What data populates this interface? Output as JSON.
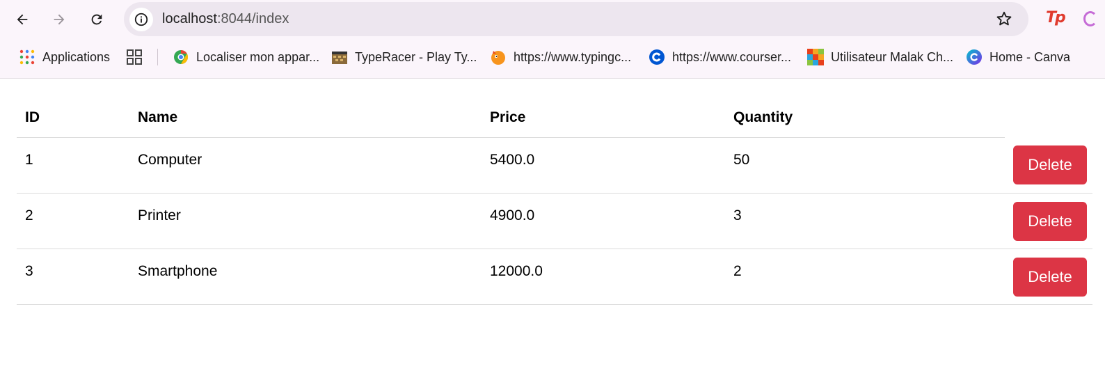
{
  "browser": {
    "url_host": "localhost",
    "url_path": ":8044/index",
    "extension_tp": "Tp",
    "bookmarks": [
      {
        "label": "Applications",
        "icon": "apps-grid-icon"
      },
      {
        "label": "",
        "icon": "tab-groups-icon"
      },
      {
        "label": "Localiser mon appar...",
        "icon": "google-find-device-icon"
      },
      {
        "label": "TypeRacer - Play Ty...",
        "icon": "typeracer-icon"
      },
      {
        "label": "https://www.typingc...",
        "icon": "typingclub-icon"
      },
      {
        "label": "https://www.courser...",
        "icon": "coursera-icon"
      },
      {
        "label": "Utilisateur Malak Ch...",
        "icon": "tinkercad-icon"
      },
      {
        "label": "Home - Canva",
        "icon": "canva-icon"
      }
    ]
  },
  "table": {
    "headers": {
      "id": "ID",
      "name": "Name",
      "price": "Price",
      "quantity": "Quantity"
    },
    "rows": [
      {
        "id": "1",
        "name": "Computer",
        "price": "5400.0",
        "quantity": "50",
        "action": "Delete"
      },
      {
        "id": "2",
        "name": "Printer",
        "price": "4900.0",
        "quantity": "3",
        "action": "Delete"
      },
      {
        "id": "3",
        "name": "Smartphone",
        "price": "12000.0",
        "quantity": "2",
        "action": "Delete"
      }
    ]
  },
  "colors": {
    "delete_button": "#dc3545",
    "chrome_background": "#fbf5fb",
    "omnibox_background": "#ede6ef"
  }
}
